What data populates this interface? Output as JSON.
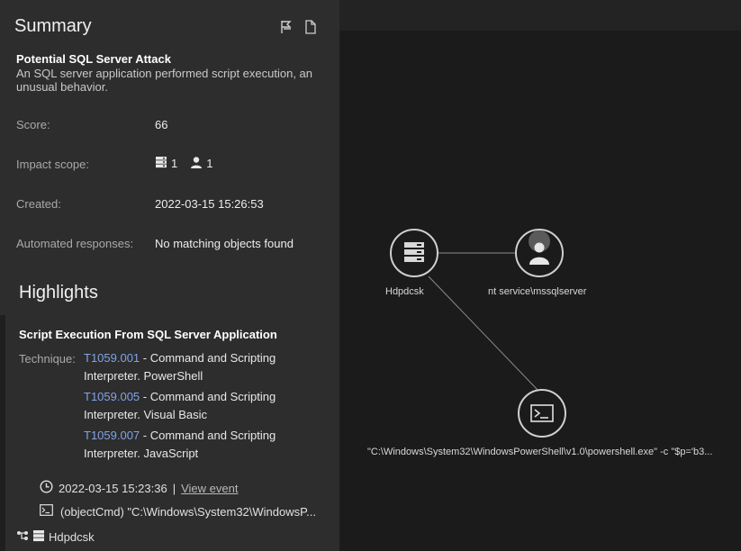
{
  "summary": {
    "title": "Summary",
    "header_icons": [
      "flag-icon",
      "document-icon"
    ]
  },
  "alert": {
    "title": "Potential SQL Server Attack",
    "description": "An SQL server application performed script execution, an unusual behavior."
  },
  "fields": {
    "score_label": "Score:",
    "score_value": "66",
    "impact_label": "Impact scope:",
    "impact_hosts": "1",
    "impact_users": "1",
    "created_label": "Created:",
    "created_value": "2022-03-15 15:26:53",
    "responses_label": "Automated responses:",
    "responses_value": "No matching objects found"
  },
  "highlights": {
    "title": "Highlights",
    "rule_title": "Script Execution From SQL Server Application",
    "technique_label": "Technique:",
    "techniques": [
      {
        "id": "T1059.001",
        "line1": " - Command and Scripting",
        "line2": "Interpreter. PowerShell"
      },
      {
        "id": "T1059.005",
        "line1": " - Command and Scripting",
        "line2": "Interpreter. Visual Basic"
      },
      {
        "id": "T1059.007",
        "line1": " - Command and Scripting",
        "line2": "Interpreter. JavaScript"
      }
    ],
    "event_time": "2022-03-15 15:23:36",
    "event_separator": "|",
    "view_event": "View event",
    "command": "(objectCmd) \"C:\\Windows\\System32\\WindowsP...",
    "host": "Hdpdcsk"
  },
  "graph": {
    "nodes": {
      "server_label": "Hdpdcsk",
      "user_label": "nt service\\mssqlserver",
      "process_label": "\"C:\\Windows\\System32\\WindowsPowerShell\\v1.0\\powershell.exe\" -c \"$p='b3..."
    }
  }
}
